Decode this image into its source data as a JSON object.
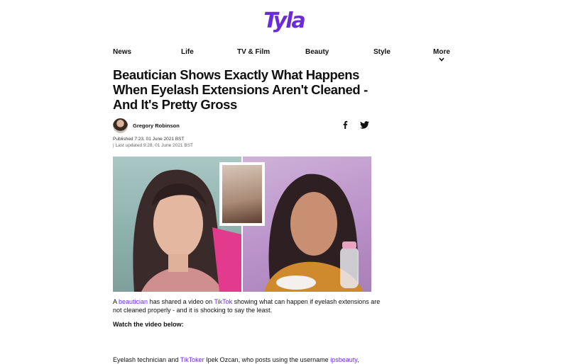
{
  "brand": {
    "logo_text": "Tyla",
    "accent_color": "#6a2bd9"
  },
  "nav": {
    "items": [
      "News",
      "Life",
      "TV & Film",
      "Beauty",
      "Style"
    ],
    "more_label": "More",
    "more_icon": "chevron-down-icon"
  },
  "article": {
    "title": "Beautician Shows Exactly What Happens When Eyelash Extensions Aren't Cleaned - And It's Pretty Gross",
    "author": "Gregory Robinson",
    "published": "Published 7:23, 01 June 2021 BST",
    "updated": "| Last updated 9:28, 01 June 2021 BST",
    "share_icons": [
      "facebook-icon",
      "twitter-icon"
    ],
    "hero_image": "Beautician speaking to camera beside a close-up of eyelash extensions and holding a bottle",
    "p1": {
      "pre": "A ",
      "link1": "beautician",
      "mid": " has shared a video on ",
      "link2": "TikTok",
      "post": " showing what can happen if eyelash extensions are not cleaned properly - and it is shocking to say the least."
    },
    "p2": "Watch the video below:",
    "p3": {
      "pre": "Eyelash technician and ",
      "link1": "TikToker",
      "mid": " Ipek Ozcan, who posts using the username ",
      "link2": "ipsbeauty",
      "post": ","
    }
  }
}
